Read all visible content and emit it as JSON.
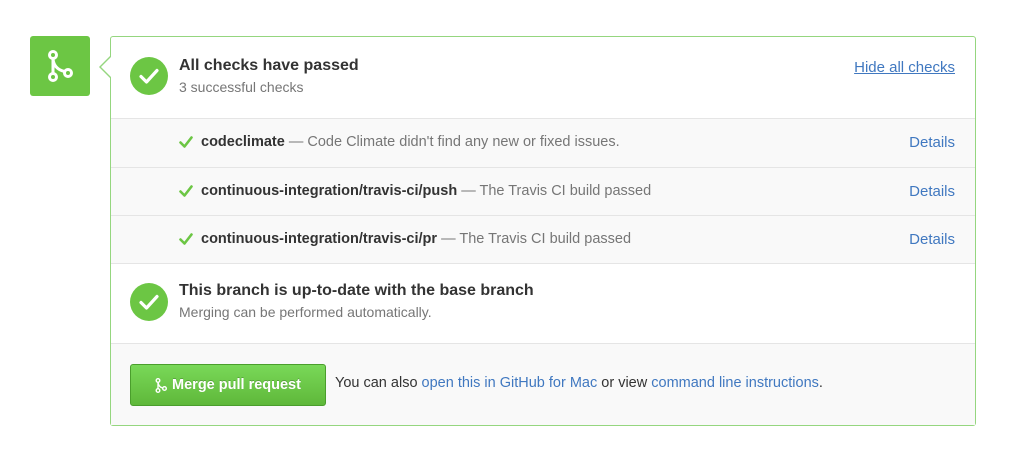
{
  "icons": {
    "merge_badge": "git-merge-icon",
    "status_ok": "check-circle-icon",
    "row_ok": "check-icon"
  },
  "colors": {
    "success_green": "#6cc644",
    "panel_border": "#95d67f",
    "link_blue": "#4078c0"
  },
  "checks_header": {
    "title": "All checks have passed",
    "subtitle": "3 successful checks",
    "hide_link": "Hide all checks"
  },
  "checks": [
    {
      "name": "codeclimate",
      "description": "— Code Climate didn't find any new or fixed issues.",
      "details_label": "Details"
    },
    {
      "name": "continuous-integration/travis-ci/push",
      "description": "— The Travis CI build passed",
      "details_label": "Details"
    },
    {
      "name": "continuous-integration/travis-ci/pr",
      "description": "— The Travis CI build passed",
      "details_label": "Details"
    }
  ],
  "branch_status": {
    "title": "This branch is up-to-date with the base branch",
    "subtitle": "Merging can be performed automatically."
  },
  "merge": {
    "button_label": "Merge pull request",
    "note_prefix": "You can also",
    "open_link": "open this in GitHub for Mac",
    "note_middle": "or view",
    "cli_link": "command line instructions",
    "note_suffix": "."
  }
}
